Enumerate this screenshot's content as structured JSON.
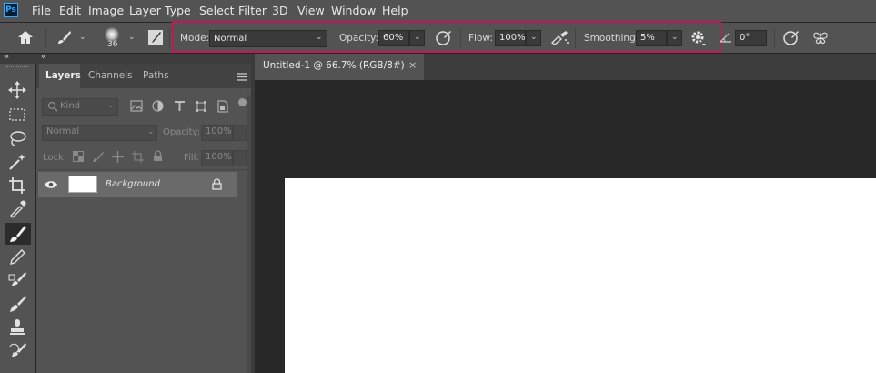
{
  "app": {
    "logo": "Ps"
  },
  "menu": [
    "File",
    "Edit",
    "Image",
    "Layer",
    "Type",
    "Select",
    "Filter",
    "3D",
    "View",
    "Window",
    "Help"
  ],
  "options_bar": {
    "brush_size": "36",
    "mode_label": "Mode:",
    "mode_value": "Normal",
    "opacity_label": "Opacity:",
    "opacity_value": "60%",
    "flow_label": "Flow:",
    "flow_value": "100%",
    "smoothing_label": "Smoothing:",
    "smoothing_value": "5%",
    "angle_value": "0°"
  },
  "panel_collapse": {
    "left": "»",
    "right": "«"
  },
  "layers_panel": {
    "tabs": [
      "Layers",
      "Channels",
      "Paths"
    ],
    "filter_placeholder": "Kind",
    "blend_mode": "Normal",
    "opacity_label": "Opacity:",
    "opacity_value": "100%",
    "lock_label": "Lock:",
    "fill_label": "Fill:",
    "fill_value": "100%",
    "layers": [
      {
        "name": "Background",
        "visible": true,
        "locked": true
      }
    ]
  },
  "document": {
    "tab_title": "Untitled-1 @ 66.7% (RGB/8#)",
    "close": "×"
  },
  "colors": {
    "highlight": "#c2185b",
    "ui_bg": "#535353",
    "dark_bg": "#262626"
  }
}
